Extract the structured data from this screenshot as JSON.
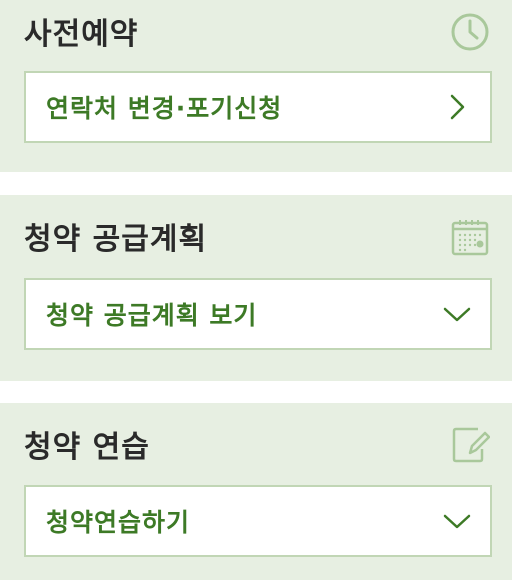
{
  "sections": [
    {
      "title": "사전예약",
      "icon": "clock-icon",
      "action_label": "연락처 변경·포기신청",
      "action_chevron": "chevron-right-icon"
    },
    {
      "title": "청약 공급계획",
      "icon": "calendar-icon",
      "action_label": "청약 공급계획 보기",
      "action_chevron": "chevron-down-icon"
    },
    {
      "title": "청약 연습",
      "icon": "edit-note-icon",
      "action_label": "청약연습하기",
      "action_chevron": "chevron-down-icon"
    }
  ],
  "colors": {
    "panel_bg": "#e7efe2",
    "accent_green": "#3d7a26",
    "border_green": "#c1d6b5",
    "icon_green": "#a9c89b",
    "title_text": "#2a2a2a"
  }
}
